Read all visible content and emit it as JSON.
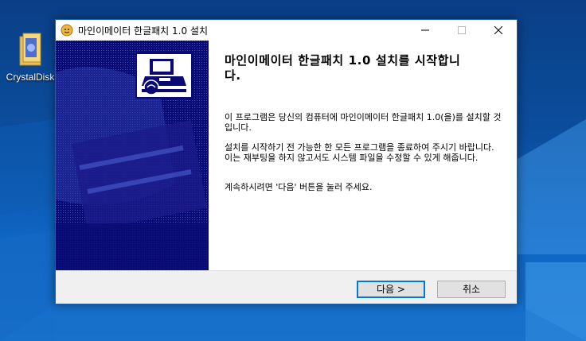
{
  "desktop": {
    "icon_label": "CrystalDisk"
  },
  "window": {
    "title": "마인이메이터 한글패치 1.0 설치",
    "controls": {
      "minimize_icon": "minimize-icon",
      "maximize_icon": "maximize-icon",
      "close_icon": "close-icon"
    },
    "heading_line1": "마인이메이터 한글패치 1.0 설치를 시작합니",
    "heading_line2": "다.",
    "paragraph1": "이 프로그램은 당신의 컴퓨터에 마인이메이터 한글패치 1.0(을)를 설치할 것입니다.",
    "paragraph2": "설치를 시작하기 전 가능한 한 모든 프로그램을 종료하여 주시기 바랍니다. 이는 재부팅을 하지 않고서도 시스템 파일을 수정할 수 있게 해줍니다.",
    "paragraph3": "계속하시려면 '다음' 버튼을 눌러 주세요.",
    "buttons": {
      "next": "다음 >",
      "cancel": "취소"
    }
  },
  "colors": {
    "side_panel": "#0a0a74",
    "accent": "#0078d7"
  }
}
